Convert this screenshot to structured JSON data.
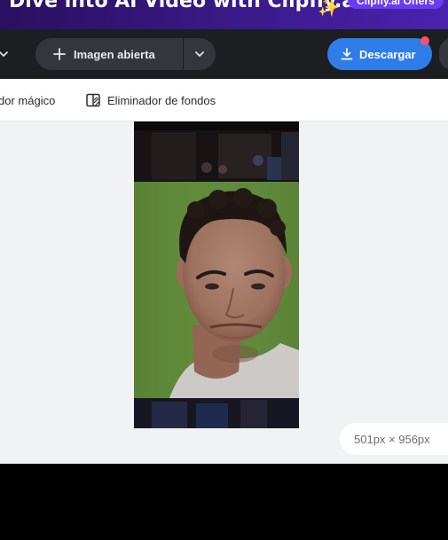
{
  "promo": {
    "title": "Dive into AI Video with Clipfly.ai",
    "sparkle": "✨",
    "badge": "Clipfly.ai Offers"
  },
  "toolbar": {
    "open_image_label": "Imagen abierta",
    "download_label": "Descargar"
  },
  "tools": {
    "magic_label": "dor mágico",
    "bg_remover_label": "Eliminador de fondos"
  },
  "canvas": {
    "size_label": "501px × 956px"
  },
  "colors": {
    "accent": "#2f7de8",
    "toolbar_bg": "#1d1e22",
    "canvas_bg": "#f1f2f4",
    "notification": "#ff4d6a"
  }
}
